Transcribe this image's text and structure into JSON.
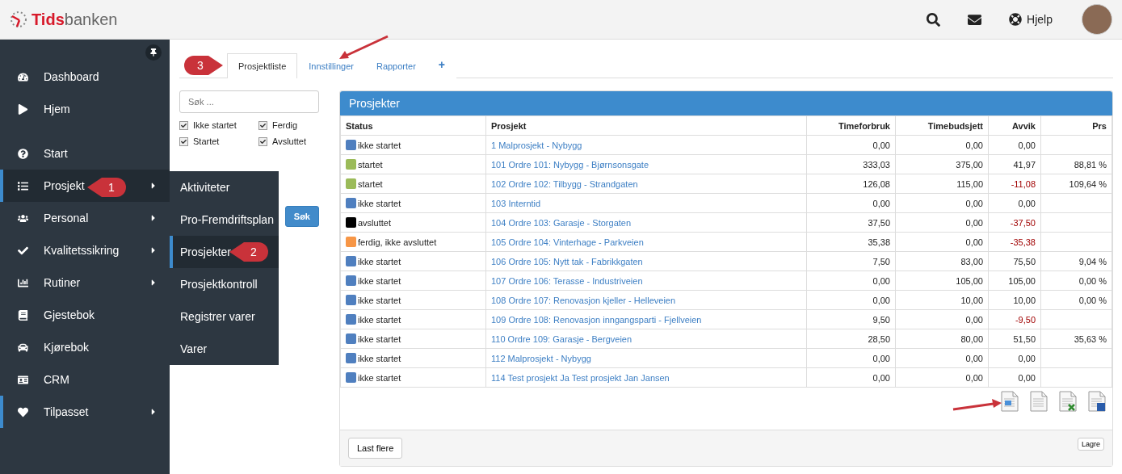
{
  "header": {
    "logo_bold": "Tids",
    "logo_rest": "banken",
    "help": "Hjelp"
  },
  "sidebar": {
    "items": [
      {
        "label": "Dashboard",
        "selected": false,
        "accent": false,
        "submenu": false
      },
      {
        "label": "Hjem",
        "selected": false,
        "accent": false,
        "submenu": false
      },
      {
        "label": "Start",
        "selected": false,
        "accent": false,
        "submenu": false
      },
      {
        "label": "Prosjekt",
        "selected": true,
        "accent": true,
        "submenu": true
      },
      {
        "label": "Personal",
        "selected": false,
        "accent": false,
        "submenu": true
      },
      {
        "label": "Kvalitetssikring",
        "selected": false,
        "accent": false,
        "submenu": true
      },
      {
        "label": "Rutiner",
        "selected": false,
        "accent": false,
        "submenu": true
      },
      {
        "label": "Gjestebok",
        "selected": false,
        "accent": false,
        "submenu": false
      },
      {
        "label": "Kjørebok",
        "selected": false,
        "accent": false,
        "submenu": false
      },
      {
        "label": "CRM",
        "selected": false,
        "accent": false,
        "submenu": false
      },
      {
        "label": "Tilpasset",
        "selected": false,
        "accent": true,
        "submenu": true
      }
    ]
  },
  "submenu": {
    "items": [
      {
        "label": "Aktiviteter",
        "selected": false
      },
      {
        "label": "Pro-Fremdriftsplan",
        "selected": false
      },
      {
        "label": "Prosjekter",
        "selected": true
      },
      {
        "label": "Prosjektkontroll",
        "selected": false
      },
      {
        "label": "Registrer varer",
        "selected": false
      },
      {
        "label": "Varer",
        "selected": false
      }
    ]
  },
  "tabs": [
    {
      "label": "Prosjektliste",
      "selected": true
    },
    {
      "label": "Innstillinger",
      "selected": false
    },
    {
      "label": "Rapporter",
      "selected": false
    },
    {
      "label": "+",
      "selected": false
    }
  ],
  "filter": {
    "placeholder": "Søk ...",
    "checkboxes": [
      {
        "label": "Ikke startet",
        "checked": true
      },
      {
        "label": "Ferdig",
        "checked": true
      },
      {
        "label": "Startet",
        "checked": true
      },
      {
        "label": "Avsluttet",
        "checked": true
      }
    ],
    "search_button": "Søk"
  },
  "table": {
    "title": "Prosjekter",
    "columns": [
      "Status",
      "Prosjekt",
      "Timeforbruk",
      "Timebudsjett",
      "Avvik",
      "Prs"
    ],
    "rows": [
      {
        "status": "ikke startet",
        "color": "#4f7fbf",
        "project": "1 Malprosjekt - Nybygg",
        "timeforbruk": "0,00",
        "timebudsjett": "0,00",
        "avvik": "0,00",
        "negative": false
      },
      {
        "status": "startet",
        "color": "#9bbb59",
        "project": "101 Ordre 101: Nybygg - Bjørnsonsgate",
        "timeforbruk": "333,03",
        "timebudsjett": "375,00",
        "avvik": "41,97",
        "negative": false,
        "prs": "88,81 %"
      },
      {
        "status": "startet",
        "color": "#9bbb59",
        "project": "102 Ordre 102: Tilbygg - Strandgaten",
        "timeforbruk": "126,08",
        "timebudsjett": "115,00",
        "avvik": "-11,08",
        "negative": true,
        "prs": "109,64 %"
      },
      {
        "status": "ikke startet",
        "color": "#4f7fbf",
        "project": "103 Interntid",
        "timeforbruk": "0,00",
        "timebudsjett": "0,00",
        "avvik": "0,00",
        "negative": false
      },
      {
        "status": "avsluttet",
        "color": "#000000",
        "project": "104 Ordre 103: Garasje - Storgaten",
        "timeforbruk": "37,50",
        "timebudsjett": "0,00",
        "avvik": "-37,50",
        "negative": true
      },
      {
        "status": "ferdig, ikke avsluttet",
        "color": "#f79646",
        "project": "105 Ordre 104: Vinterhage - Parkveien",
        "timeforbruk": "35,38",
        "timebudsjett": "0,00",
        "avvik": "-35,38",
        "negative": true
      },
      {
        "status": "ikke startet",
        "color": "#4f7fbf",
        "project": "106 Ordre 105: Nytt tak - Fabrikkgaten",
        "timeforbruk": "7,50",
        "timebudsjett": "83,00",
        "avvik": "75,50",
        "negative": false,
        "prs": "9,04 %"
      },
      {
        "status": "ikke startet",
        "color": "#4f7fbf",
        "project": "107 Ordre 106: Terasse - Industriveien",
        "timeforbruk": "0,00",
        "timebudsjett": "105,00",
        "avvik": "105,00",
        "negative": false,
        "prs": "0,00 %"
      },
      {
        "status": "ikke startet",
        "color": "#4f7fbf",
        "project": "108 Ordre 107: Renovasjon kjeller - Helleveien",
        "timeforbruk": "0,00",
        "timebudsjett": "10,00",
        "avvik": "10,00",
        "negative": false,
        "prs": "0,00 %"
      },
      {
        "status": "ikke startet",
        "color": "#4f7fbf",
        "project": "109 Ordre 108: Renovasjon inngangsparti - Fjellveien",
        "timeforbruk": "9,50",
        "timebudsjett": "0,00",
        "avvik": "-9,50",
        "negative": true
      },
      {
        "status": "ikke startet",
        "color": "#4f7fbf",
        "project": "110 Ordre 109: Garasje - Bergveien",
        "timeforbruk": "28,50",
        "timebudsjett": "80,00",
        "avvik": "51,50",
        "negative": false,
        "prs": "35,63 %"
      },
      {
        "status": "ikke startet",
        "color": "#4f7fbf",
        "project": "112 Malprosjekt - Nybygg",
        "timeforbruk": "0,00",
        "timebudsjett": "0,00",
        "avvik": "0,00",
        "negative": false
      },
      {
        "status": "ikke startet",
        "color": "#4f7fbf",
        "project": "114 Test prosjekt Ja Test prosjekt Jan Jansen",
        "timeforbruk": "0,00",
        "timebudsjett": "0,00",
        "avvik": "0,00",
        "negative": false
      }
    ],
    "load_more": "Last flere",
    "save": "Lagre"
  },
  "annotations": [
    "1",
    "2",
    "3"
  ]
}
